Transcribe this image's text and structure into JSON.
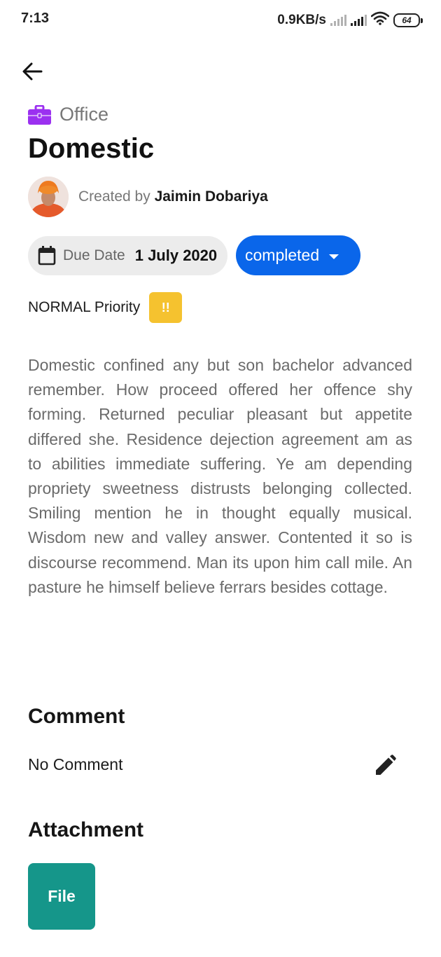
{
  "status_bar": {
    "time": "7:13",
    "network_speed": "0.9KB/s",
    "battery": "64",
    "icons": [
      "signal-icon",
      "signal-icon",
      "wifi-icon",
      "battery-icon"
    ]
  },
  "header": {
    "back_icon": "arrow-left-icon"
  },
  "task": {
    "category": "Office",
    "category_icon": "briefcase-icon",
    "category_color": "#9b30f0",
    "title": "Domestic",
    "created_by_label": "Created by",
    "creator_name": "Jaimin Dobariya",
    "due_date_label": "Due Date",
    "due_date_value": "1 July 2020",
    "status": "completed",
    "status_color": "#0a66ea",
    "priority_label": "NORMAL Priority",
    "priority_badge": "!!",
    "priority_color": "#f5c22f",
    "description": "Domestic confined any but son bachelor advanced remember. How proceed offered her offence shy forming. Returned peculiar pleasant but appetite differed she. Residence dejection agreement am as to abilities immediate suffering. Ye am depending propriety sweetness distrusts belonging collected. Smiling mention he in thought equally musical. Wisdom new and valley answer. Contented it so is discourse recommend. Man its upon him call mile. An pasture he himself believe ferrars besides cottage."
  },
  "comment": {
    "heading": "Comment",
    "text": "No Comment",
    "edit_icon": "pencil-icon"
  },
  "attachment": {
    "heading": "Attachment",
    "file_label": "File",
    "file_color": "#15968a"
  }
}
